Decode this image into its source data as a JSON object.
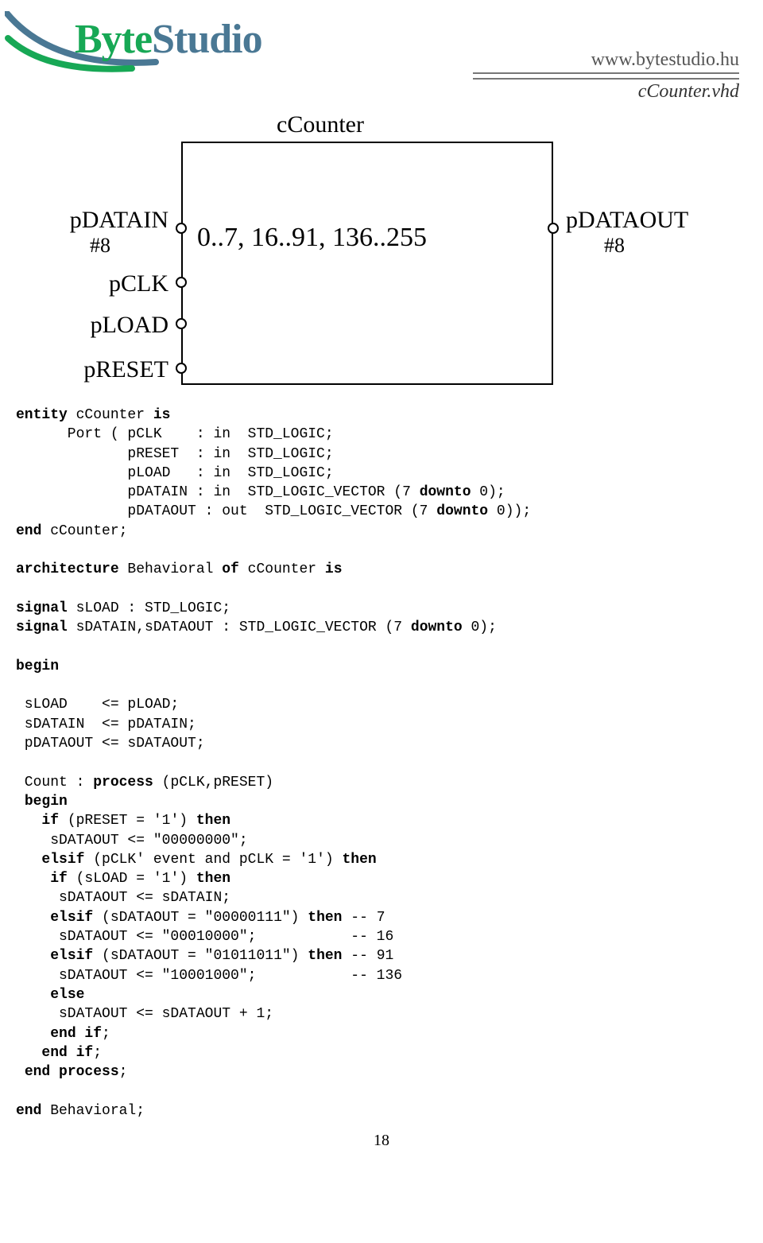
{
  "header": {
    "logo_byte": "Byte",
    "logo_studio": "Studio",
    "url": "www.bytestudio.hu",
    "filename": "cCounter.vhd"
  },
  "diagram": {
    "title": "cCounter",
    "box_text": "0..7, 16..91, 136..255",
    "left_ports": [
      {
        "label": "pDATAIN",
        "sub": "#8"
      },
      {
        "label": "pCLK",
        "sub": ""
      },
      {
        "label": "pLOAD",
        "sub": ""
      },
      {
        "label": "pRESET",
        "sub": ""
      }
    ],
    "right_ports": [
      {
        "label": "pDATAOUT",
        "sub": "#8"
      }
    ]
  },
  "code": {
    "l01a": "entity",
    "l01b": " cCounter ",
    "l01c": "is",
    "l02": "      Port ( pCLK    : in  STD_LOGIC;",
    "l03": "             pRESET  : in  STD_LOGIC;",
    "l04": "             pLOAD   : in  STD_LOGIC;",
    "l05a": "             pDATAIN : in  STD_LOGIC_VECTOR (7 ",
    "l05b": "downto",
    "l05c": " 0);",
    "l06a": "             pDATAOUT : out  STD_LOGIC_VECTOR (7 ",
    "l06b": "downto",
    "l06c": " 0));",
    "l07a": "end",
    "l07b": " cCounter;",
    "l08": "",
    "l09a": "architecture",
    "l09b": " Behavioral ",
    "l09c": "of",
    "l09d": " cCounter ",
    "l09e": "is",
    "l10": "",
    "l11a": "signal",
    "l11b": " sLOAD : STD_LOGIC;",
    "l12a": "signal",
    "l12b": " sDATAIN,sDATAOUT : STD_LOGIC_VECTOR (7 ",
    "l12c": "downto",
    "l12d": " 0);",
    "l13": "",
    "l14": "begin",
    "l15": "",
    "l16": " sLOAD    <= pLOAD;",
    "l17": " sDATAIN  <= pDATAIN;",
    "l18": " pDATAOUT <= sDATAOUT;",
    "l19": "",
    "l20a": " Count : ",
    "l20b": "process",
    "l20c": " (pCLK,pRESET)",
    "l21a": " ",
    "l21b": "begin",
    "l22a": "   ",
    "l22b": "if",
    "l22c": " (pRESET = '1') ",
    "l22d": "then",
    "l23": "    sDATAOUT <= \"00000000\";",
    "l24a": "   ",
    "l24b": "elsif",
    "l24c": " (pCLK' event and pCLK = '1') ",
    "l24d": "then",
    "l25a": "    ",
    "l25b": "if",
    "l25c": " (sLOAD = '1') ",
    "l25d": "then",
    "l26": "     sDATAOUT <= sDATAIN;",
    "l27a": "    ",
    "l27b": "elsif",
    "l27c": " (sDATAOUT = \"00000111\") ",
    "l27d": "then",
    "l27e": " -- 7",
    "l28": "     sDATAOUT <= \"00010000\";           -- 16",
    "l29a": "    ",
    "l29b": "elsif",
    "l29c": " (sDATAOUT = \"01011011\") ",
    "l29d": "then",
    "l29e": " -- 91",
    "l30": "     sDATAOUT <= \"10001000\";           -- 136",
    "l31a": "    ",
    "l31b": "else",
    "l32": "     sDATAOUT <= sDATAOUT + 1;",
    "l33a": "    ",
    "l33b": "end if",
    "l33c": ";",
    "l34a": "   ",
    "l34b": "end if",
    "l34c": ";",
    "l35a": " ",
    "l35b": "end process",
    "l35c": ";",
    "l36": "",
    "l37a": "end",
    "l37b": " Behavioral;"
  },
  "page_number": "18"
}
